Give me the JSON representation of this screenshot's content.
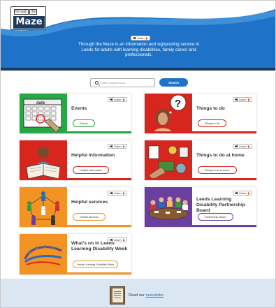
{
  "header": {
    "logo_small": "through",
    "logo_the": "the",
    "logo_big": "Maze",
    "listen_label": "Listen",
    "tagline": "Through the Maze is an information and signposting service in Leeds for adults with learning disabilities, family carers and professionals.",
    "colors": {
      "primary": "#1e73c8",
      "dark": "#1b3a5c"
    }
  },
  "search": {
    "placeholder": "Enter a search term...",
    "button_label": "Search"
  },
  "cards": [
    {
      "title": "Events",
      "button": "Events",
      "color": "#28a745",
      "image": "calendar-icon",
      "listen": "Listen"
    },
    {
      "title": "Things to do",
      "button": "Things to do",
      "color": "#d7261e",
      "image": "thinking-person-icon",
      "listen": "Listen"
    },
    {
      "title": "Helpful Information",
      "button": "Helpful Information",
      "color": "#d7261e",
      "image": "reading-person-icon",
      "listen": "Listen"
    },
    {
      "title": "Things to do at home",
      "button": "Things to do at home",
      "color": "#d7261e",
      "image": "home-activities-icon",
      "listen": "Listen"
    },
    {
      "title": "Helpful services",
      "button": "Helpful services",
      "color": "#f39324",
      "image": "people-network-icon",
      "listen": "Listen"
    },
    {
      "title": "Leeds Learning Disability Partnership Board",
      "button": "Partnership Board",
      "color": "#6b3fa0",
      "image": "meeting-table-icon",
      "listen": "Listen"
    },
    {
      "title": "What's on in Leeds Learning Disability Week",
      "button": "Leeds Learning Disability Week",
      "color": "#f39324",
      "image": "ld-week-logo",
      "listen": "Listen"
    }
  ],
  "footer": {
    "text": "Read our",
    "link": "newsletter",
    "icon": "newsletter-icon"
  }
}
